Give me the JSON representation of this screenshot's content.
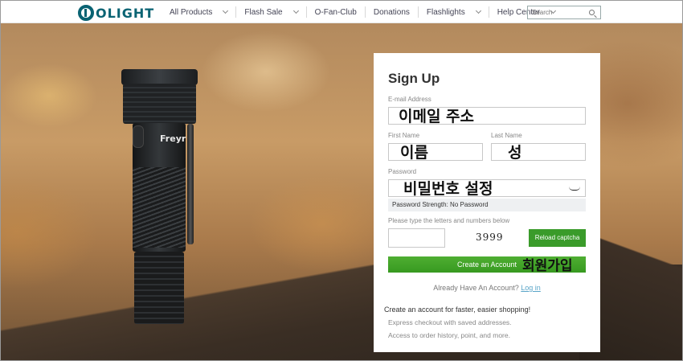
{
  "header": {
    "logo_text": "OLIGHT",
    "nav": [
      {
        "label": "All Products",
        "has_dropdown": true
      },
      {
        "label": "Flash Sale",
        "has_dropdown": true
      },
      {
        "label": "O-Fan-Club",
        "has_dropdown": false
      },
      {
        "label": "Donations",
        "has_dropdown": false
      },
      {
        "label": "Flashlights",
        "has_dropdown": true
      },
      {
        "label": "Help Center",
        "has_dropdown": true
      }
    ],
    "search_placeholder": "Search"
  },
  "hero": {
    "product_brand": "Freyr"
  },
  "signup": {
    "title": "Sign Up",
    "email_label": "E-mail Address",
    "email_annotation": "이메일 주소",
    "first_name_label": "First Name",
    "first_name_annotation": "이름",
    "last_name_label": "Last Name",
    "last_name_annotation": "성",
    "password_label": "Password",
    "password_annotation": "비밀번호 설정",
    "password_strength": "Password Strength: No Password",
    "captcha_label": "Please type the letters and numbers below",
    "captcha_text": "3999",
    "reload_label": "Reload captcha",
    "create_label": "Create an Account",
    "create_annotation": "회원가입",
    "already_text": "Already Have An Account?",
    "login_label": "Log in",
    "promo_title": "Create an account for faster, easier shopping!",
    "promo_items": [
      "Express checkout with saved addresses.",
      "Access to order history, point, and more."
    ]
  }
}
